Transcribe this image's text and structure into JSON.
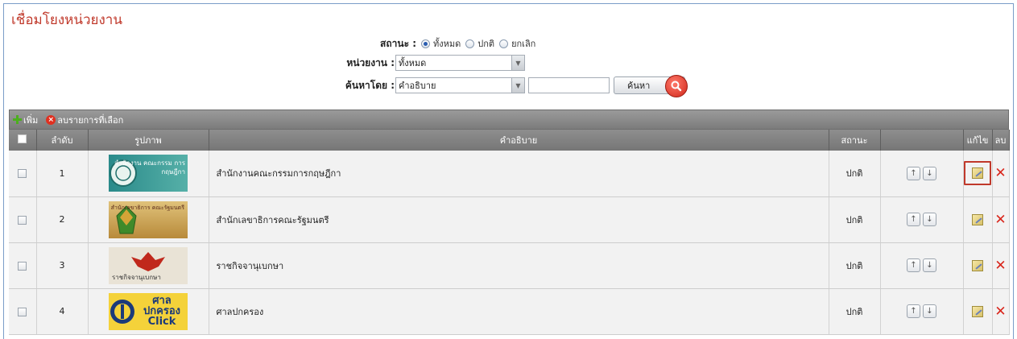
{
  "header": {
    "title": "เชื่อมโยงหน่วยงาน"
  },
  "filters": {
    "status_label": "สถานะ :",
    "status_options": [
      {
        "label": "ทั้งหมด",
        "selected": true
      },
      {
        "label": "ปกติ",
        "selected": false
      },
      {
        "label": "ยกเลิก",
        "selected": false
      }
    ],
    "unit_label": "หน่วยงาน :",
    "unit_value": "ทั้งหมด",
    "search_by_label": "ค้นหาโดย :",
    "search_by_value": "คำอธิบาย",
    "search_text": "",
    "search_button": "ค้นหา"
  },
  "toolbar": {
    "add_label": "เพิ่ม",
    "delete_selected_label": "ลบรายการที่เลือก"
  },
  "table": {
    "columns": {
      "select": "",
      "order": "ลำดับ",
      "image": "รูปภาพ",
      "description": "คำอธิบาย",
      "status": "สถานะ",
      "move": "",
      "edit": "แก้ไข",
      "delete": "ลบ"
    },
    "rows": [
      {
        "order": "1",
        "image_caption": "สำนักงาน คณะกรรม การกฤษฎีกา",
        "description": "สำนักงานคณะกรรมการกฤษฎีกา",
        "status": "ปกติ",
        "edit_highlighted": true
      },
      {
        "order": "2",
        "image_caption": "สำนักเลขาธิการ คณะรัฐมนตรี",
        "description": "สำนักเลขาธิการคณะรัฐมนตรี",
        "status": "ปกติ",
        "edit_highlighted": false
      },
      {
        "order": "3",
        "image_caption": "ราชกิจจานุเบกษา",
        "description": "ราชกิจจานุเบกษา",
        "status": "ปกติ",
        "edit_highlighted": false
      },
      {
        "order": "4",
        "image_caption": "ศาล ปกครอง Click",
        "description": "ศาลปกครอง",
        "status": "ปกติ",
        "edit_highlighted": false
      }
    ]
  },
  "colors": {
    "title": "#c0392b",
    "header_bg": "#828282",
    "row_bg": "#f2f2f2",
    "delete": "#d9261c"
  },
  "icons": {
    "add": "plus-icon",
    "delete_selected": "delete-circle-icon",
    "search": "magnifier-icon",
    "up": "arrow-up-icon",
    "down": "arrow-down-icon",
    "edit": "edit-icon",
    "delete": "close-icon"
  }
}
